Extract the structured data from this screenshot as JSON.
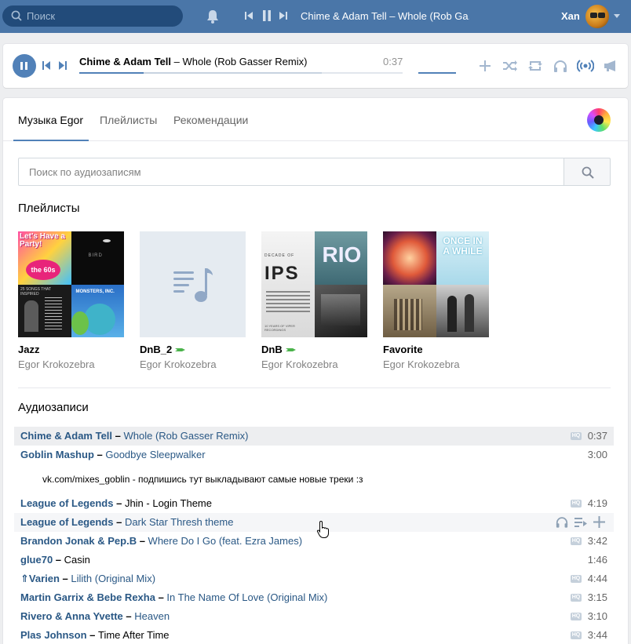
{
  "header": {
    "search_placeholder": "Поиск",
    "now_playing": "Chime & Adam Tell – Whole (Rob Ga...",
    "user_name": "Xan"
  },
  "player": {
    "artist": "Chime & Adam Tell",
    "separator": " – ",
    "title": "Whole (Rob Gasser Remix)",
    "time": "0:37"
  },
  "tabs": [
    {
      "label": "Музыка Egor",
      "active": true
    },
    {
      "label": "Плейлисты",
      "active": false
    },
    {
      "label": "Рекомендации",
      "active": false
    }
  ],
  "audio_search_placeholder": "Поиск по аудиозаписям",
  "playlists_title": "Плейлисты",
  "playlists": [
    {
      "name": "Jazz",
      "owner": "Egor Krokozebra"
    },
    {
      "name": "DnB_2",
      "owner": "Egor Krokozebra"
    },
    {
      "name": "DnB",
      "owner": "Egor Krokozebra"
    },
    {
      "name": "Favorite",
      "owner": "Egor Krokozebra"
    }
  ],
  "cover_text": {
    "jazz_party": "Let's Have a Party!",
    "jazz_sixties": "the 60s",
    "jazz_bird": "BIRD",
    "jazz_songs": "25 SONGS THAT INSPIRED",
    "jazz_monsters": "MONSTERS, INC.",
    "dnb_decade": "DECADE OF",
    "dnb_ips": "IPS",
    "dnb_rio": "RIO",
    "dnb_years": "10 YEARS OF VIPER RECORDINGS",
    "fav_once": "ONCE IN A WHILE"
  },
  "tracks_title": "Аудиозаписи",
  "tracks": [
    {
      "artist": "Chime & Adam Tell",
      "title": "Whole (Rob Gasser Remix)",
      "hq": "HQ",
      "duration": "0:37"
    },
    {
      "artist": "Goblin Mashup",
      "title": "Goodbye Sleepwalker",
      "duration": "3:00"
    },
    {
      "note": "vk.com/mixes_goblin - подпишись тут выкладывают самые новые треки :з"
    },
    {
      "artist": "League of Legends",
      "title": "Jhin - Login Theme",
      "hq": "HQ",
      "duration": "4:19"
    },
    {
      "artist": "League of Legends",
      "title": "Dark Star Thresh theme"
    },
    {
      "artist": "Brandon Jonak & Pep.B",
      "title": "Where Do I Go (feat. Ezra James)",
      "hq": "HQ",
      "duration": "3:42"
    },
    {
      "artist": "glue70",
      "title": "Casin",
      "duration": "1:46"
    },
    {
      "artist": "⇑Varien",
      "title": "Lilith (Original Mix)",
      "hq": "HQ",
      "duration": "4:44"
    },
    {
      "artist": "Martin Garrix & Bebe Rexha",
      "title": "In The Name Of Love (Original Mix)",
      "hq": "HQ",
      "duration": "3:15"
    },
    {
      "artist": "Rivero & Anna Yvette",
      "title": "Heaven",
      "hq": "HQ",
      "duration": "3:10"
    },
    {
      "artist": "Plas Johnson",
      "title": "Time After Time",
      "hq": "HQ",
      "duration": "3:44"
    }
  ],
  "colors": {
    "header": "#4a76a8",
    "accent": "#5181b8",
    "link": "#2a5885",
    "shuffle_badge": "#4bb34b"
  },
  "progress": {
    "played_fraction": 0.2,
    "buffered_fraction": 0.75
  }
}
